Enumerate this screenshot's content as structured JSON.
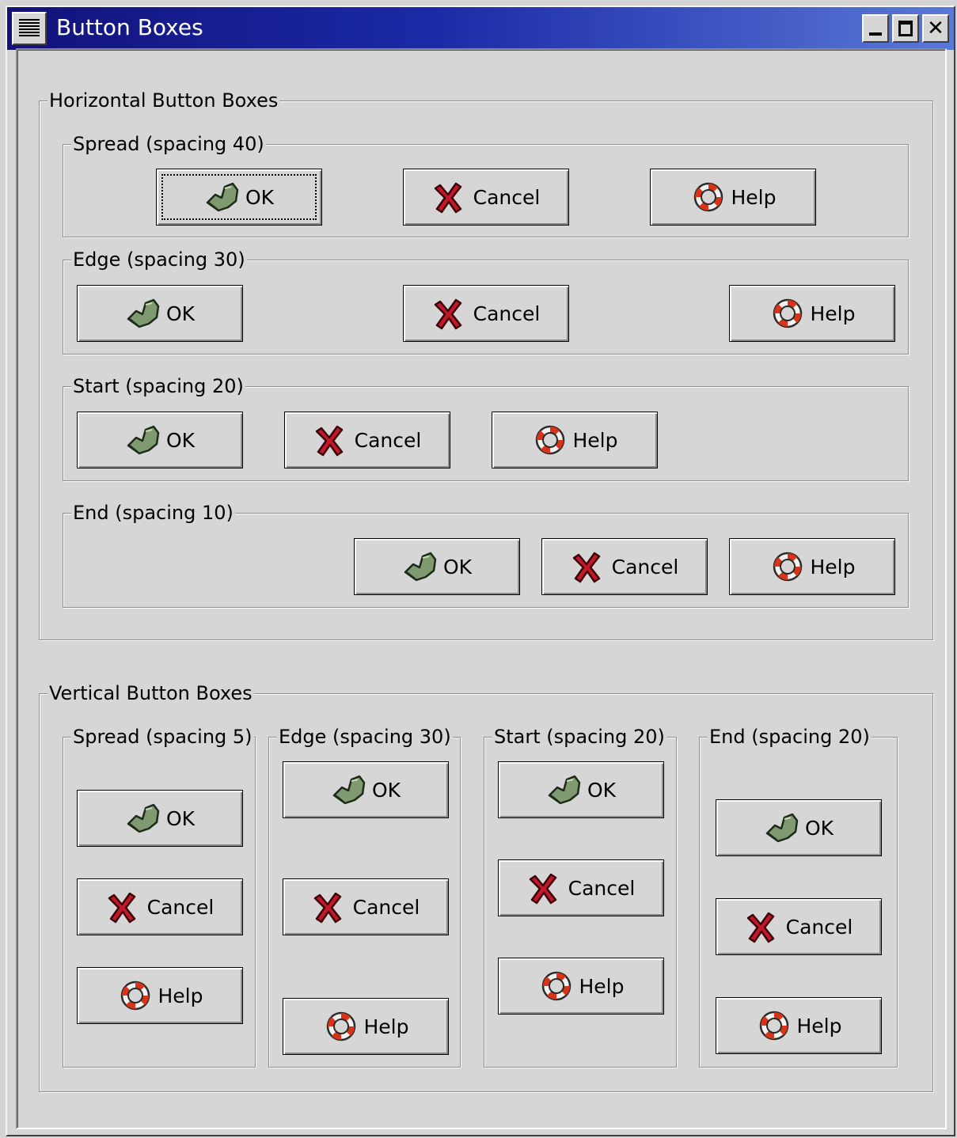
{
  "window": {
    "title": "Button Boxes"
  },
  "labels": {
    "ok": "OK",
    "cancel": "Cancel",
    "help": "Help"
  },
  "horizontal": {
    "title": "Horizontal Button Boxes",
    "frames": [
      "Spread (spacing 40)",
      "Edge (spacing 30)",
      "Start (spacing 20)",
      "End (spacing 10)"
    ]
  },
  "vertical": {
    "title": "Vertical Button Boxes",
    "frames": [
      "Spread (spacing 5)",
      "Edge (spacing 30)",
      "Start (spacing 20)",
      "End (spacing 20)"
    ]
  },
  "focused_button": "Spread (spacing 40) - OK",
  "icons": {
    "ok": "thumbs-ok-icon",
    "cancel": "red-x-icon",
    "help": "lifebuoy-icon"
  }
}
